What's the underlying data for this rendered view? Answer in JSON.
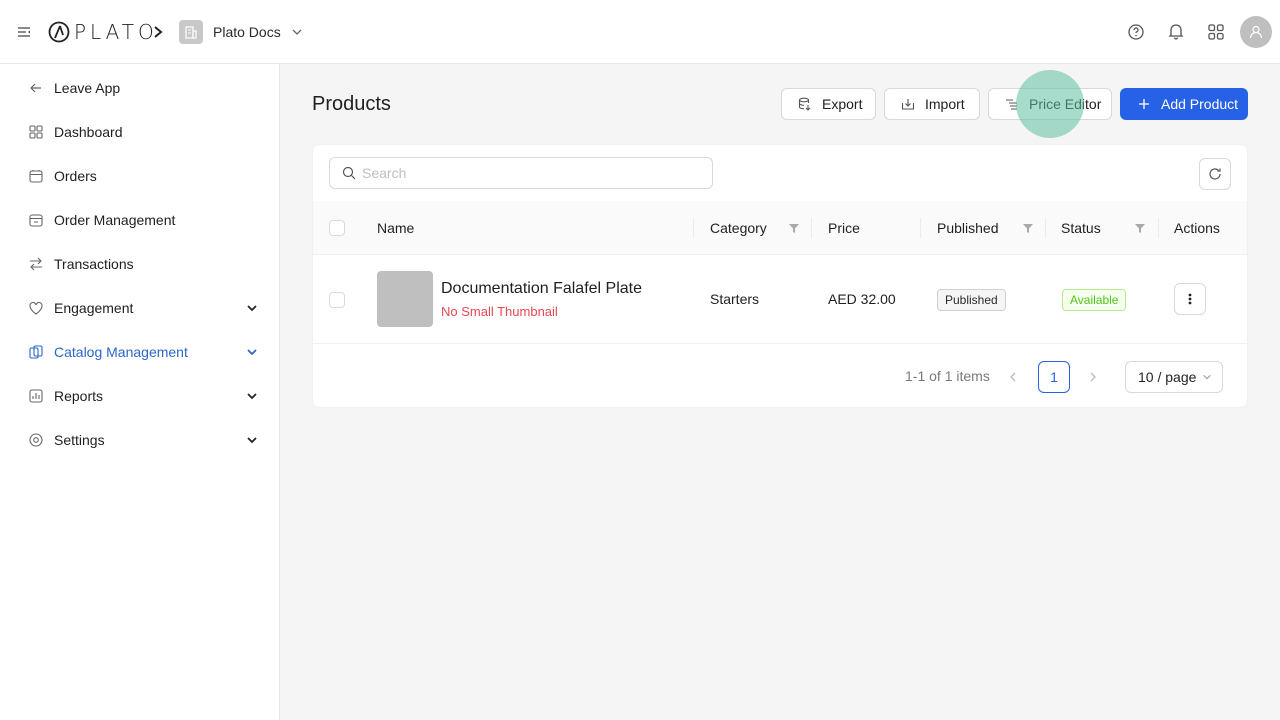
{
  "header": {
    "logo_text": "PLATO",
    "org_name": "Plato Docs",
    "icons": [
      "menu-icon",
      "chevron-right-icon",
      "building-icon",
      "chevron-down-icon",
      "help-icon",
      "bell-icon",
      "apps-grid-icon",
      "user-icon"
    ]
  },
  "sidebar": {
    "items": [
      {
        "label": "Leave App",
        "icon": "arrow-left-icon"
      },
      {
        "label": "Dashboard",
        "icon": "dashboard-icon"
      },
      {
        "label": "Orders",
        "icon": "orders-icon"
      },
      {
        "label": "Order Management",
        "icon": "order-management-icon"
      },
      {
        "label": "Transactions",
        "icon": "transfer-icon"
      },
      {
        "label": "Engagement",
        "icon": "heart-icon",
        "expandable": true
      },
      {
        "label": "Catalog Management",
        "icon": "catalog-icon",
        "expandable": true,
        "active": true
      },
      {
        "label": "Reports",
        "icon": "reports-icon",
        "expandable": true
      },
      {
        "label": "Settings",
        "icon": "settings-icon",
        "expandable": true
      }
    ]
  },
  "page": {
    "title": "Products",
    "buttons": {
      "export": "Export",
      "import": "Import",
      "price_editor": "Price Editor",
      "add_product": "Add Product"
    }
  },
  "search": {
    "placeholder": "Search",
    "value": ""
  },
  "table": {
    "columns": [
      "Name",
      "Category",
      "Price",
      "Published",
      "Status",
      "Actions"
    ],
    "rows": [
      {
        "name": "Documentation Falafel Plate",
        "thumbnail_note": "No Small Thumbnail",
        "category": "Starters",
        "price": "AED 32.00",
        "published": "Published",
        "status": "Available"
      }
    ]
  },
  "pagination": {
    "total_text": "1-1 of 1 items",
    "current_page": "1",
    "page_size": "10 / page"
  },
  "colors": {
    "primary": "#2761e6",
    "active_nav": "#2b66c9",
    "warning_text": "#e8484f",
    "available_green": "#52c41a"
  }
}
